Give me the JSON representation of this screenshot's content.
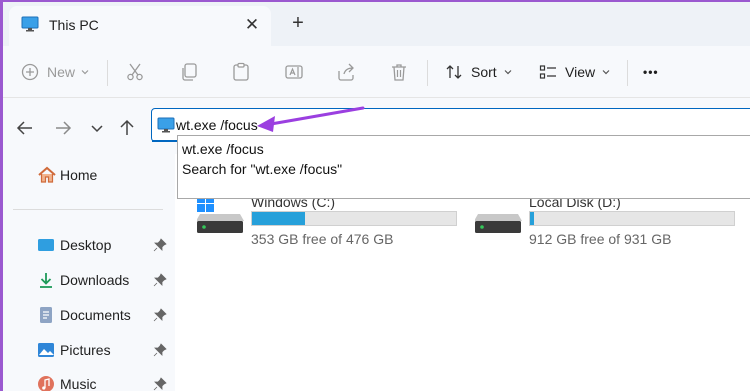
{
  "window": {
    "tab_title": "This PC",
    "tab_icon": "monitor-icon",
    "close_glyph": "✕",
    "add_glyph": "+"
  },
  "toolbar": {
    "new_label": "New",
    "sort_label": "Sort",
    "view_label": "View",
    "more_glyph": "•••"
  },
  "address": {
    "value": "wt.exe /focus",
    "icon": "monitor-icon"
  },
  "autocomplete": {
    "items": [
      "wt.exe /focus",
      "Search for \"wt.exe /focus\""
    ]
  },
  "sidebar": {
    "home_label": "Home",
    "items": [
      {
        "label": "Desktop",
        "icon": "desktop-icon"
      },
      {
        "label": "Downloads",
        "icon": "downloads-icon"
      },
      {
        "label": "Documents",
        "icon": "documents-icon"
      },
      {
        "label": "Pictures",
        "icon": "pictures-icon"
      },
      {
        "label": "Music",
        "icon": "music-icon"
      }
    ]
  },
  "drives": [
    {
      "name": "Windows (C:)",
      "free_text": "353 GB free of 476 GB",
      "used_fraction": 0.258
    },
    {
      "name": "Local Disk (D:)",
      "free_text": "912 GB free of 931 GB",
      "used_fraction": 0.02
    }
  ],
  "colors": {
    "accent": "#0067c0",
    "annotation_arrow": "#9b3fe0",
    "drive_bar": "#26a0da"
  }
}
